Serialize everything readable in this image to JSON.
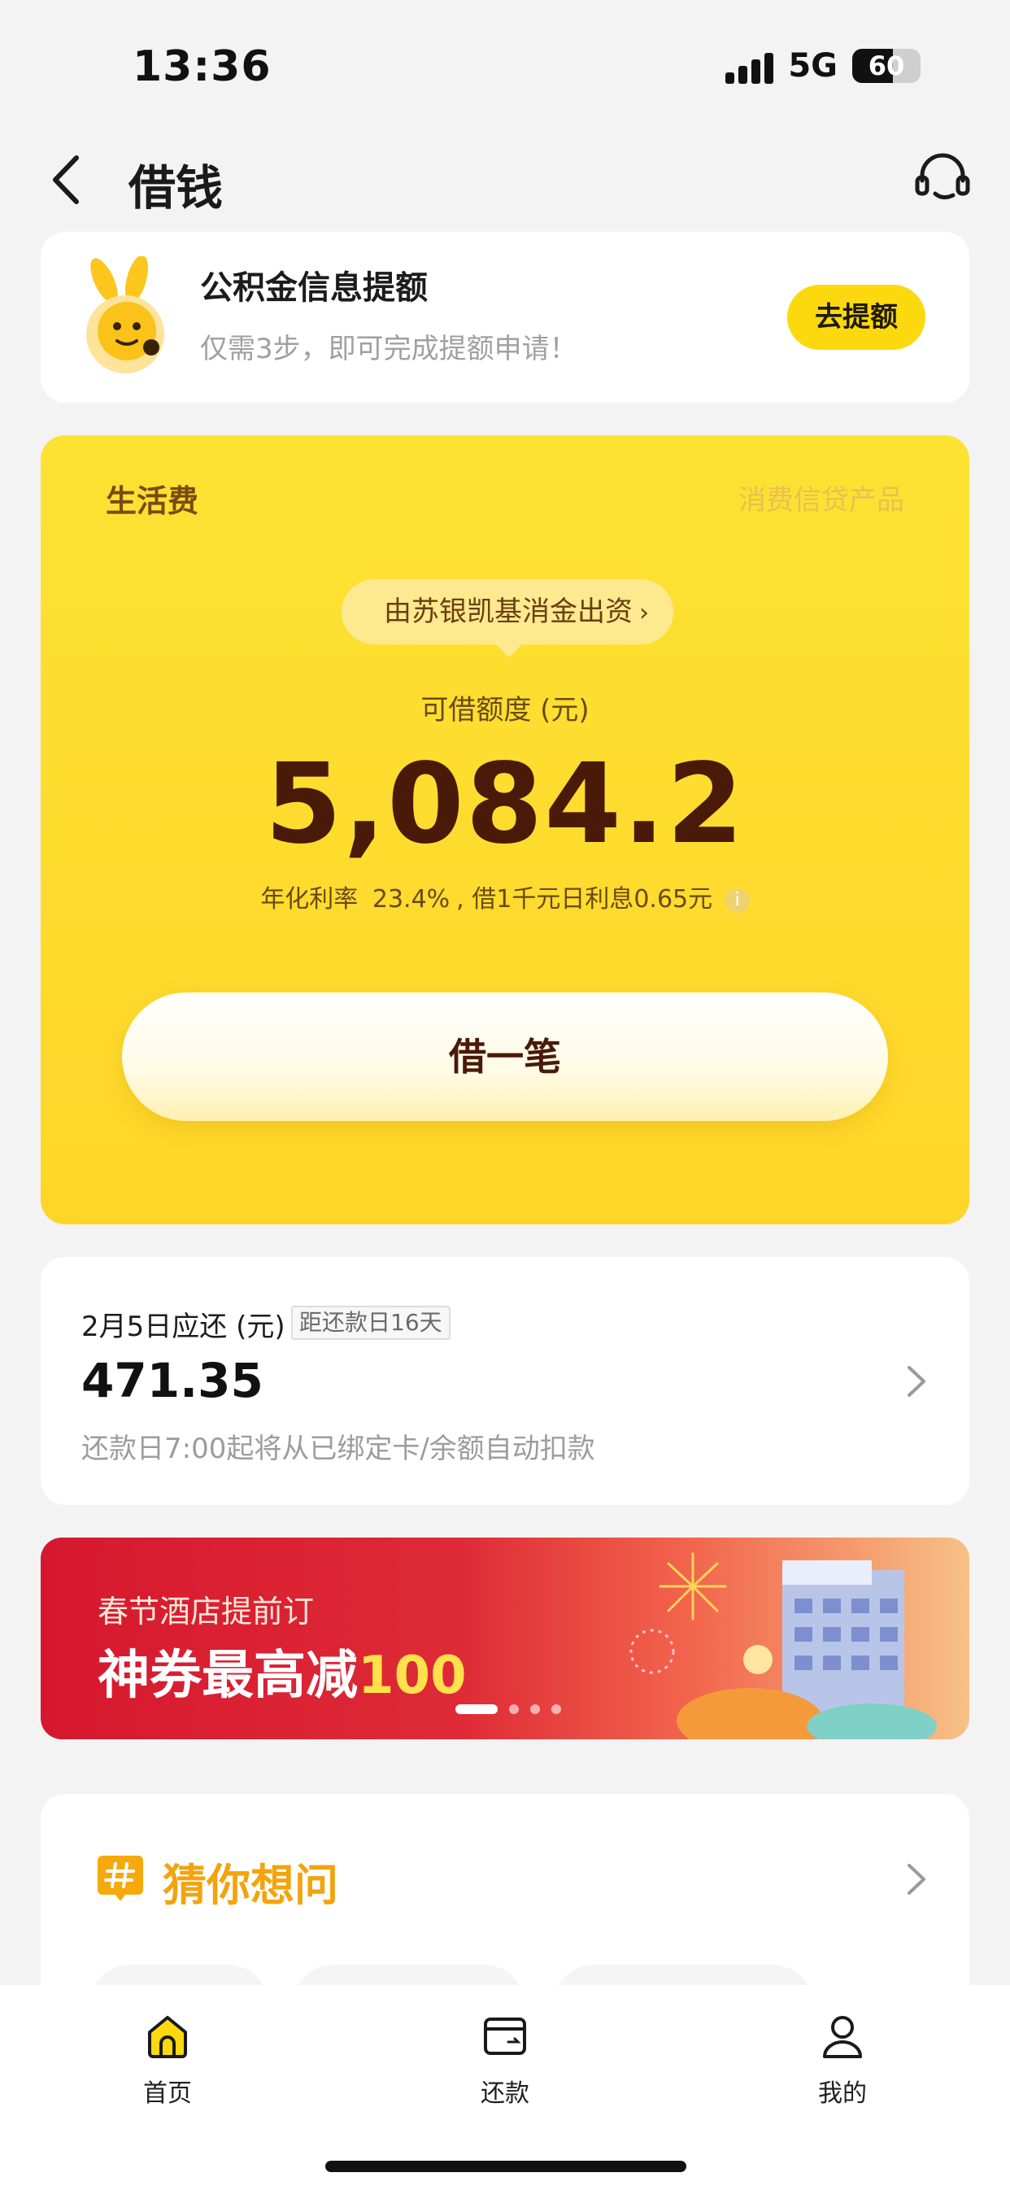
{
  "status_bar": {
    "time": "13:36",
    "network": "5G",
    "battery": "60"
  },
  "nav": {
    "title": "借钱",
    "back_icon": "chevron-left-icon",
    "service_icon": "headset-icon"
  },
  "promo": {
    "title": "公积金信息提额",
    "subtitle": "仅需3步，即可完成提额申请！",
    "button": "去提额",
    "mascot_icon": "rabbit-mascot-icon"
  },
  "loan": {
    "product_name": "生活费",
    "product_type": "消费信贷产品",
    "funder": "由苏银凯基消金出资",
    "funder_chevron": "›",
    "limit_label": "可借额度 (元)",
    "limit_value": "5,084.2",
    "rate_prefix": "年化利率",
    "rate_value": "23.4%",
    "rate_suffix": ", 借1千元日利息0.65元",
    "borrow_button": "借一笔",
    "accent_color": "#fed62a"
  },
  "repay": {
    "due_label": "2月5日应还 (元)",
    "due_badge": "距还款日16天",
    "amount": "471.35",
    "note": "还款日7:00起将从已绑定卡/余额自动扣款"
  },
  "banner": {
    "subtitle": "春节酒店提前订",
    "title_prefix": "神券最高减",
    "title_highlight": "100"
  },
  "guess": {
    "title": "猜你想问",
    "icon": "hash-icon"
  },
  "tabbar": {
    "items": [
      {
        "label": "首页",
        "icon": "home-icon"
      },
      {
        "label": "还款",
        "icon": "wallet-icon"
      },
      {
        "label": "我的",
        "icon": "user-icon"
      }
    ]
  }
}
